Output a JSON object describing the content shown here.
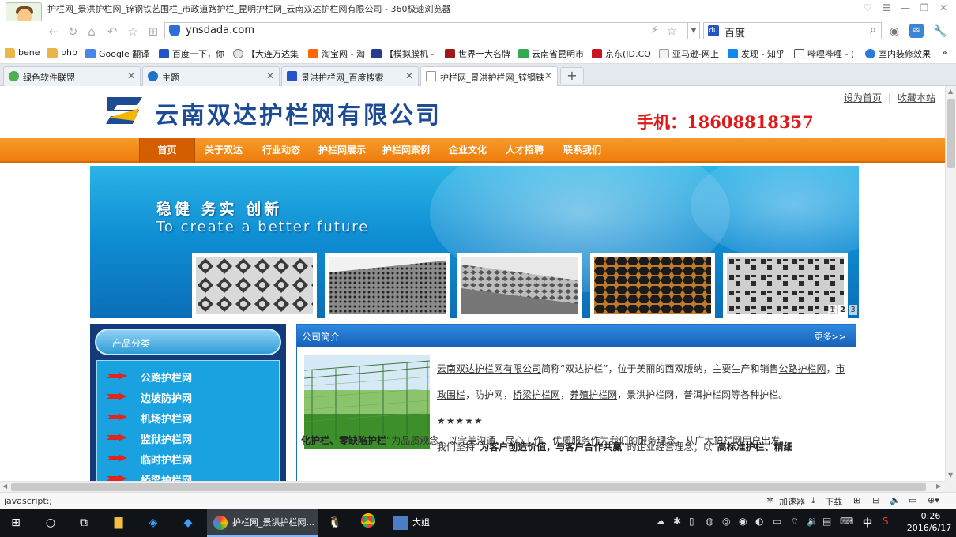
{
  "browser": {
    "window_title": "护栏网_景洪护栏网_锌钢铁艺围栏_市政道路护栏_昆明护栏网_云南双达护栏网有限公司 - 360极速浏览器",
    "url": "ynsdada.com",
    "search_engine": "百度",
    "bookmarks": [
      {
        "label": "bene",
        "icon": "folder-icon"
      },
      {
        "label": "php",
        "icon": "folder-icon"
      },
      {
        "label": "Google 翻译",
        "icon": "google-translate-icon"
      },
      {
        "label": "百度一下，你",
        "icon": "baidu-icon"
      },
      {
        "label": "【大连万达集",
        "icon": "wanda-icon"
      },
      {
        "label": "淘宝网 - 淘",
        "icon": "taobao-icon"
      },
      {
        "label": "【模拟膜机 -",
        "icon": "bookmark-icon"
      },
      {
        "label": "世界十大名牌",
        "icon": "w-icon"
      },
      {
        "label": "云南省昆明市",
        "icon": "map-icon"
      },
      {
        "label": "京东(JD.CO",
        "icon": "jd-icon"
      },
      {
        "label": "亚马逊-网上",
        "icon": "amazon-icon"
      },
      {
        "label": "发现 - 知乎",
        "icon": "zhihu-icon"
      },
      {
        "label": "哔哩哔哩 - (",
        "icon": "bilibili-icon"
      },
      {
        "label": "室内装修效果",
        "icon": "decor-icon"
      }
    ],
    "bookmarks_more": "»",
    "tabs": [
      {
        "label": "绿色软件联盟",
        "active": false
      },
      {
        "label": "主题",
        "active": false
      },
      {
        "label": "景洪护栏网_百度搜索",
        "active": false
      },
      {
        "label": "护栏网_景洪护栏网_锌钢铁",
        "active": true
      }
    ],
    "new_tab_label": "+",
    "status_text": "javascript:;",
    "statusbar_items": [
      "加速器",
      "下载"
    ]
  },
  "site": {
    "company_name": "云南双达护栏网有限公司",
    "header_links": [
      "设为首页",
      "收藏本站"
    ],
    "header_link_sep": "|",
    "phone": "手机：18608818357",
    "nav": [
      "首页",
      "关于双达",
      "行业动态",
      "护栏网展示",
      "护栏网案例",
      "企业文化",
      "人才招聘",
      "联系我们"
    ],
    "banner": {
      "slogan": "稳健 务实 创新",
      "sub": "To create a better future",
      "slide_numbers": [
        "1",
        "2",
        "3"
      ],
      "current_slide": 2
    },
    "sidebar": {
      "title": "产品分类",
      "items": [
        "公路护栏网",
        "边坡防护网",
        "机场护栏网",
        "监狱护栏网",
        "临时护栏网",
        "桥梁护栏网"
      ]
    },
    "profile": {
      "title": "公司简介",
      "more": "更多>>",
      "p1_link1": "云南双达护栏网有限公司",
      "p1_text1": "简称“双达护栏”，位于美丽的西双版纳，主要生产和销售",
      "p1_link2": "公路护栏网",
      "p1_sep1": "，",
      "p1_link3": "市政围栏",
      "p1_text2": "，防护网，",
      "p1_link4": "桥梁护栏网",
      "p1_sep2": "，",
      "p1_link5": "养殖护栏网",
      "p1_text3": "，景洪护栏网，普洱护栏网等各种护栏。",
      "stars": "★★★★★",
      "p2_text1": "我们坚持“",
      "p2_bold1": "为客户创造价值，与客户合作共赢",
      "p2_text2": "”的企业经营理念；以“",
      "p2_bold2a": "高标准护栏、精细",
      "p2_bold2b": "化护栏、零缺陷护栏",
      "p2_text3": "”为品质观念，以完美沟通、尽心工作、优质服务作为我们的服务理念，从广大护栏网用户出发，"
    }
  },
  "taskbar": {
    "apps": [
      {
        "label": "护栏网_景洪护栏网...",
        "active": true
      },
      {
        "label": "大姐",
        "active": false
      }
    ],
    "ime": "中",
    "time": "0:26",
    "date": "2016/6/17"
  },
  "colors": {
    "nav_orange": "#ef7e0d",
    "nav_active": "#d55f00",
    "brand_blue": "#1e4c94",
    "phone_red": "#e01818",
    "sidebar_navy": "#143a7a",
    "sidebar_cyan": "#1aa1e0",
    "profile_header": "#1661b8"
  }
}
